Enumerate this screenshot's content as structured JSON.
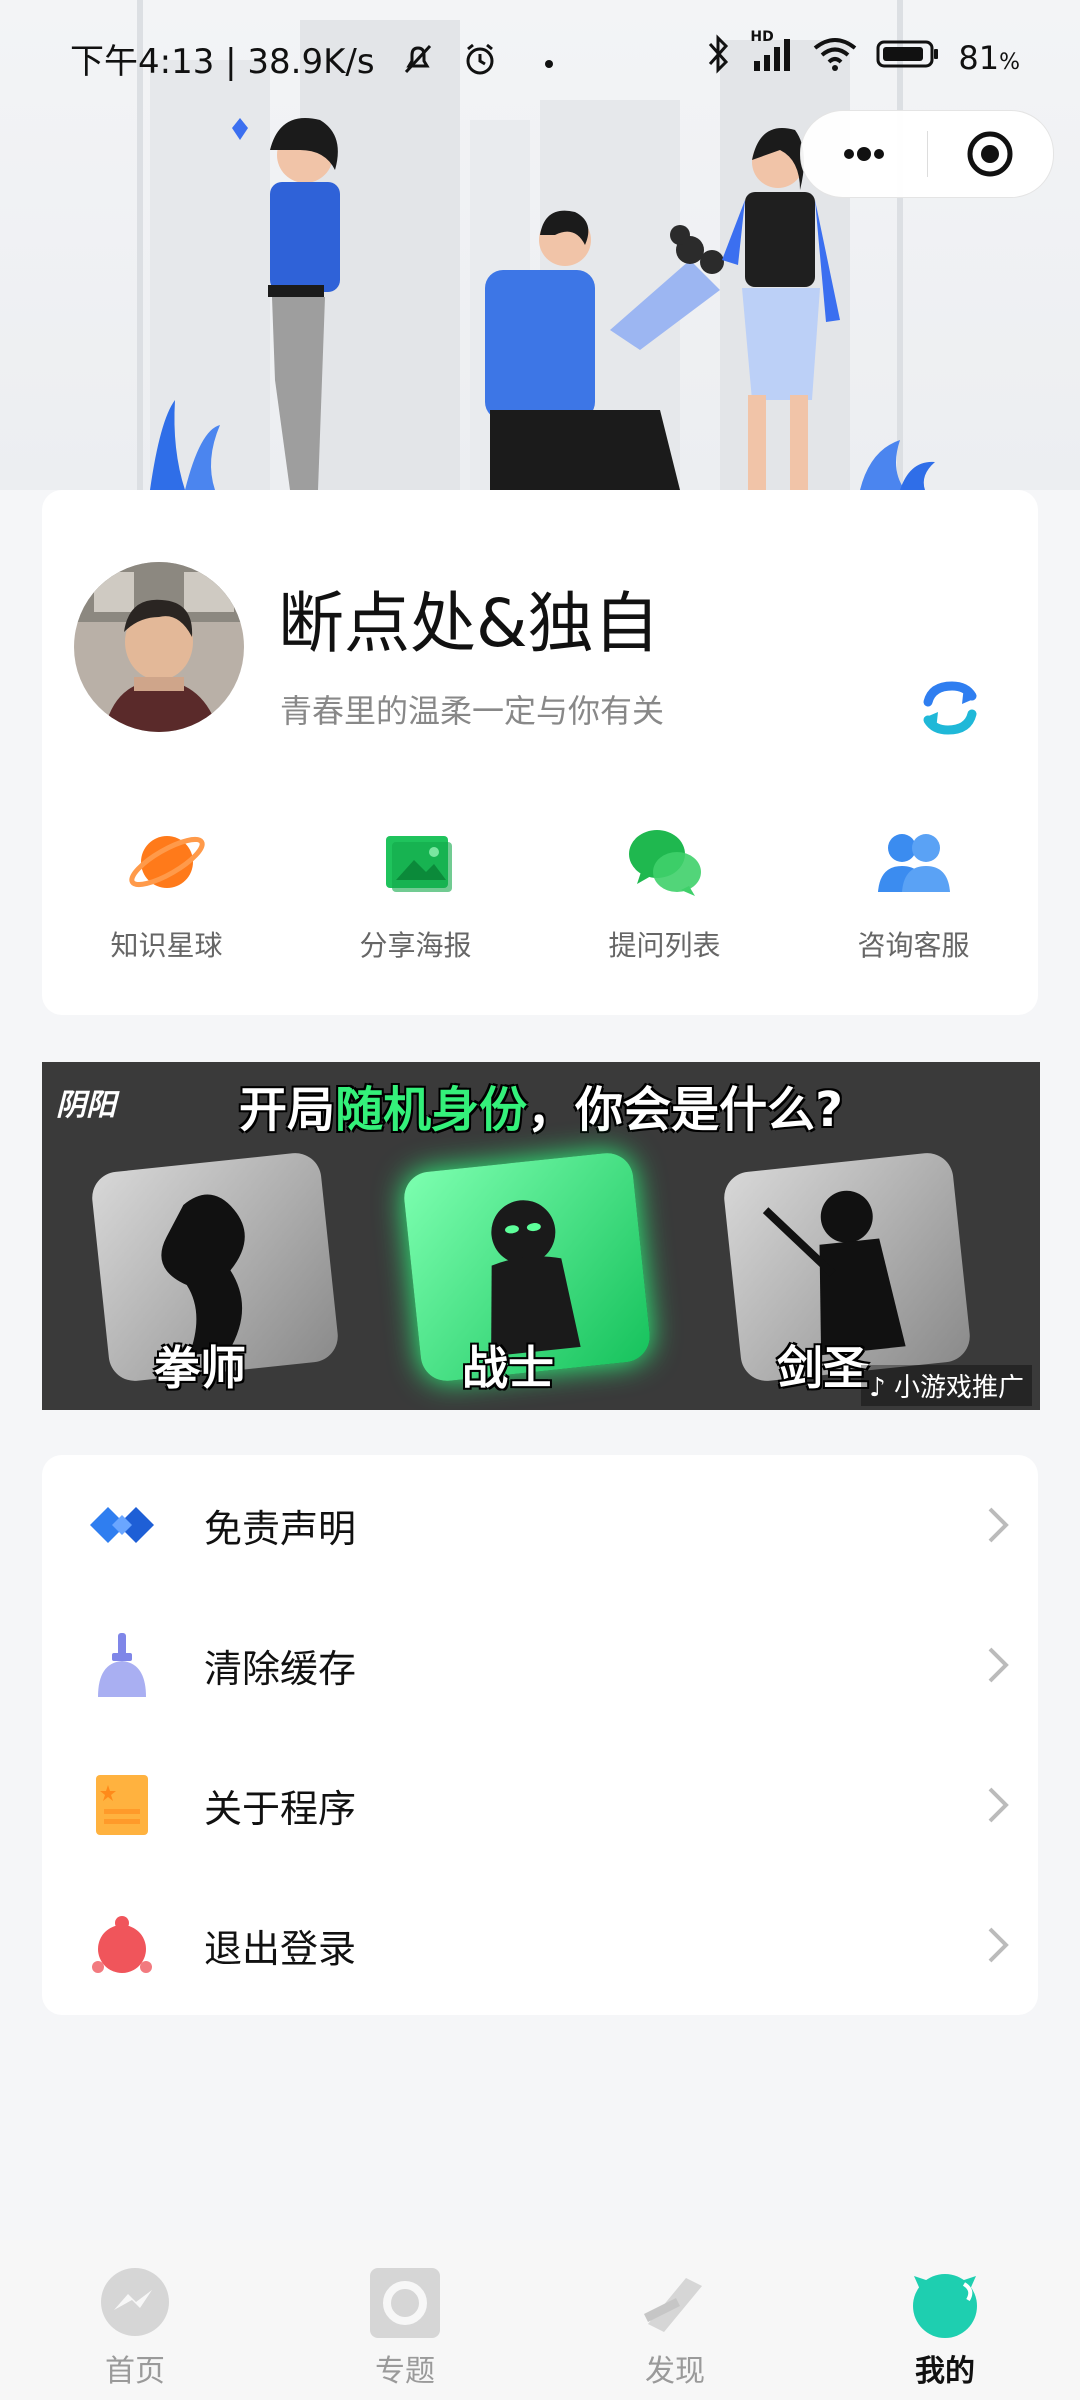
{
  "status_bar": {
    "time_speed": "下午4:13 | 38.9K/s",
    "battery": "81",
    "battery_unit": "%",
    "network_badge": "HD"
  },
  "profile": {
    "name": "断点处&独自",
    "signature": "青春里的温柔一定与你有关"
  },
  "quick_actions": [
    {
      "label": "知识星球",
      "icon": "planet-icon",
      "color": "#ff7a1a"
    },
    {
      "label": "分享海报",
      "icon": "poster-icon",
      "color": "#1fc35c"
    },
    {
      "label": "提问列表",
      "icon": "chat-bubbles-icon",
      "color": "#22c35a"
    },
    {
      "label": "咨询客服",
      "icon": "customer-service-icon",
      "color": "#3b8cf0"
    }
  ],
  "banner": {
    "logo_text": "阴阳",
    "title_prefix": "开局",
    "title_highlight": "随机身份",
    "title_suffix": "，你会是什么?",
    "characters": [
      "拳师",
      "战士",
      "剑圣"
    ],
    "promo_tag": "小游戏推广"
  },
  "menu": [
    {
      "label": "免责声明",
      "icon": "handshake-icon"
    },
    {
      "label": "清除缓存",
      "icon": "broom-icon"
    },
    {
      "label": "关于程序",
      "icon": "document-icon"
    },
    {
      "label": "退出登录",
      "icon": "logout-icon"
    }
  ],
  "tabs": [
    {
      "label": "首页",
      "icon": "messenger-icon",
      "active": false
    },
    {
      "label": "专题",
      "icon": "topic-icon",
      "active": false
    },
    {
      "label": "发现",
      "icon": "discover-icon",
      "active": false
    },
    {
      "label": "我的",
      "icon": "profile-icon",
      "active": true
    }
  ],
  "colors": {
    "accent_blue": "#2f7ef0",
    "active_tab": "#1ecfb0",
    "page_bg": "#f5f6f8"
  }
}
